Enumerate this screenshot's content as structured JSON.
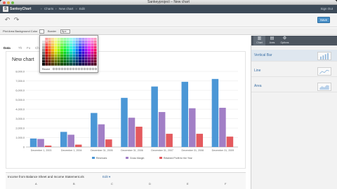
{
  "window": {
    "title": "Sankeyproject – New chart",
    "controls": {
      "close": "#ec5f57",
      "minimize": "#e2b440",
      "zoom": "#72be47"
    }
  },
  "navbar": {
    "logo_letter": "S",
    "logo_text": "SankeyChart",
    "breadcrumbs": [
      "Charts",
      "New chart",
      "Edit"
    ],
    "right_link": "Sign Out"
  },
  "toolbar": {
    "undo_icon": "undo-icon",
    "redo_icon": "redo-icon",
    "save_label": "Save"
  },
  "optbar": {
    "label": "Plot Area   Background Color",
    "border_label": "Border",
    "border_value": "5px"
  },
  "color_picker": {
    "selected_label": "#1",
    "recent_label": "Recent"
  },
  "subtabs": [
    "Data",
    "Th",
    "Fo",
    "Ch"
  ],
  "chart_data": {
    "type": "bar",
    "title": "New chart",
    "categories": [
      "December 1, 2003",
      "December 1, 2004",
      "December 31, 2005",
      "December 31, 2006",
      "December 31, 2007",
      "December 31, 2008",
      "December 31, 2009"
    ],
    "series": [
      {
        "name": "Revenues",
        "color": "#4b97d6",
        "values": [
          900,
          1600,
          3600,
          5200,
          6400,
          6900,
          7200
        ]
      },
      {
        "name": "Gross Margin",
        "color": "#a27fc6",
        "values": [
          850,
          1300,
          2400,
          3100,
          3700,
          4100,
          4150
        ]
      },
      {
        "name": "Retained Profit for the Year",
        "color": "#e45a5e",
        "values": [
          150,
          250,
          800,
          2150,
          1400,
          1400,
          1100
        ]
      }
    ],
    "ylim": [
      0,
      8000
    ],
    "yticks": [
      "0",
      "1,000.0",
      "2,000.0",
      "3,000.0",
      "4,000.0",
      "5,000.0",
      "6,000.0",
      "7,000.0",
      "8,000.0"
    ],
    "grid": true,
    "legend_position": "bottom"
  },
  "sidebar": {
    "tabs": [
      {
        "label": "Chart",
        "icon": "chart-type-icon"
      },
      {
        "label": "Axes",
        "icon": "axes-icon"
      },
      {
        "label": "Options",
        "icon": "gear-icon"
      }
    ],
    "chart_types": [
      {
        "label": "Vertical Bar",
        "thumb": "bar-thumb-icon"
      },
      {
        "label": "Line",
        "thumb": "line-thumb-icon"
      },
      {
        "label": "Area",
        "thumb": "area-thumb-icon"
      }
    ]
  },
  "bottom_table": {
    "title": "Income from Balance Sheet and Income Statement.xls",
    "edit_label": "Edit ▾",
    "columns": [
      "A",
      "B",
      "C",
      "D",
      "E",
      "F"
    ]
  }
}
